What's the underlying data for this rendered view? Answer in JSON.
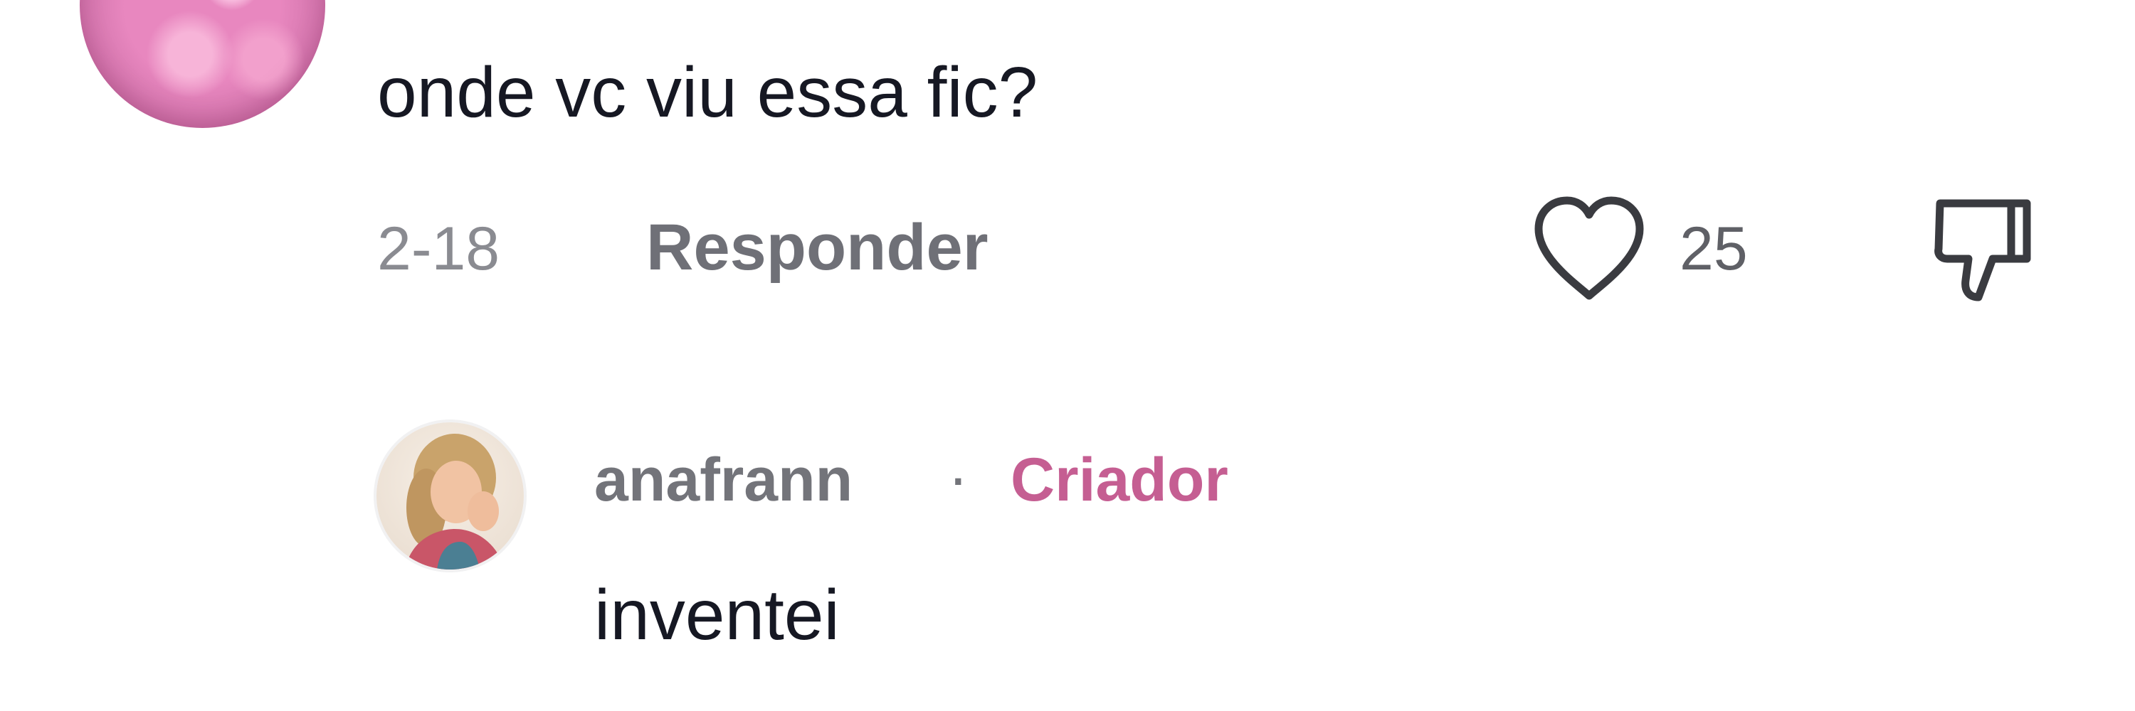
{
  "comment": {
    "text": "onde vc viu essa fic?",
    "date": "2-18",
    "reply_label": "Responder",
    "like_count": "25",
    "icons": {
      "like": "heart-icon",
      "dislike": "thumbs-down-icon"
    }
  },
  "reply": {
    "username": "anafrann",
    "separator": "·",
    "badge": "Criador",
    "text": "inventei"
  },
  "colors": {
    "text_primary": "#161823",
    "text_secondary": "#8a8b91",
    "creator_accent": "#c55e92",
    "background": "#ffffff"
  }
}
